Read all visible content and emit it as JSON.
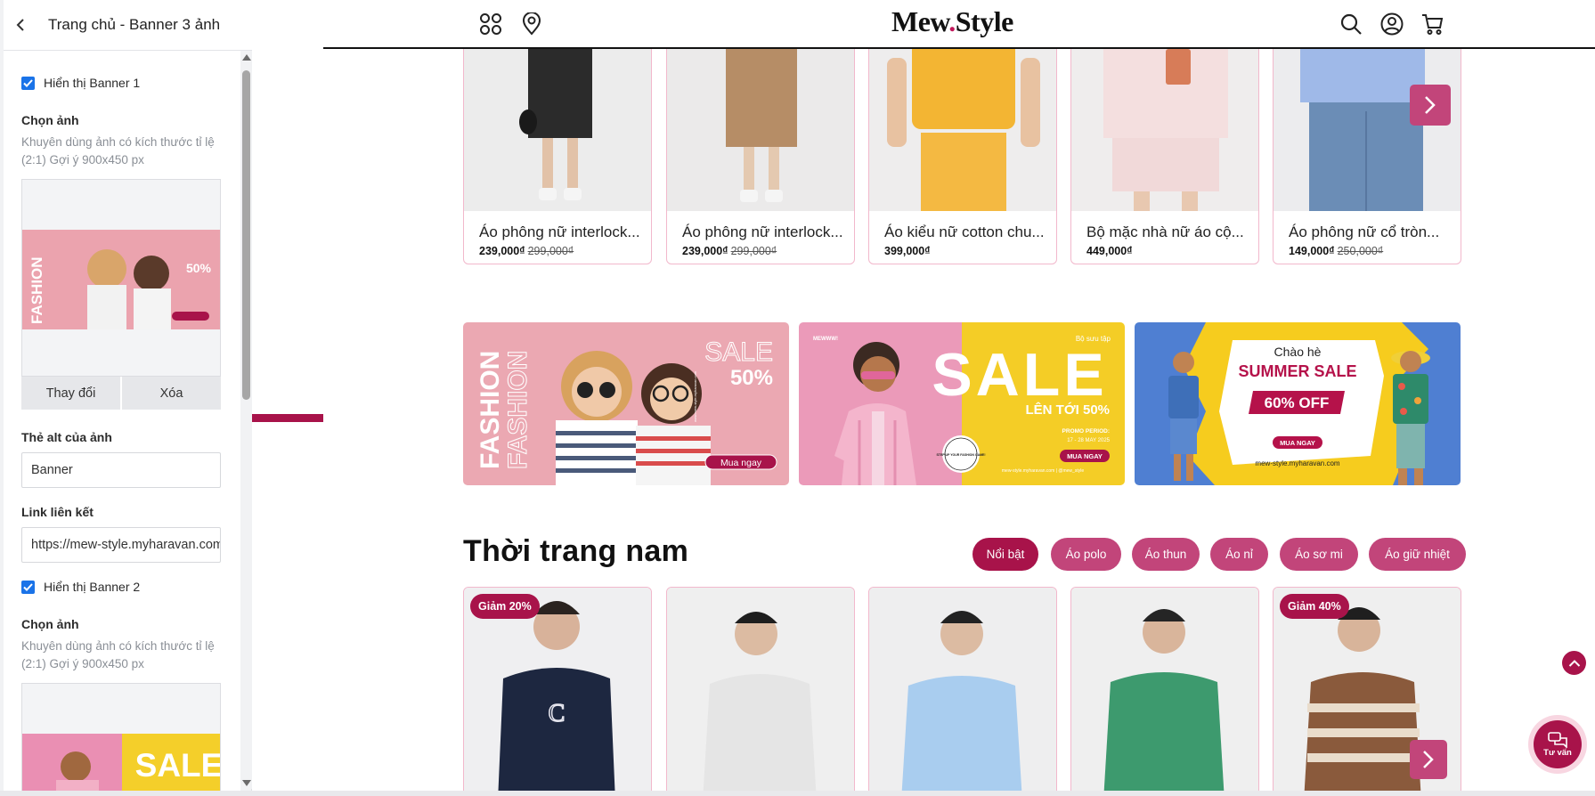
{
  "sidebar": {
    "title": "Trang chủ - Banner 3 ảnh",
    "banner1": {
      "show_label": "Hiển thị Banner 1",
      "choose_image_label": "Chọn ảnh",
      "hint": "Khuyên dùng ảnh có kích thước tỉ lệ (2:1) Gợi ý 900x450 px",
      "change_button": "Thay đổi",
      "delete_button": "Xóa",
      "alt_label": "Thẻ alt của ảnh",
      "alt_value": "Banner",
      "link_label": "Link liên kết",
      "link_value": "https://mew-style.myharavan.com"
    },
    "banner2": {
      "show_label": "Hiển thị Banner 2",
      "choose_image_label": "Chọn ảnh",
      "hint": "Khuyên dùng ảnh có kích thước tỉ lệ (2:1) Gợi ý 900x450 px"
    }
  },
  "site": {
    "logo_left": "Mew",
    "logo_dot": ".",
    "logo_right": "Style",
    "products_top": [
      {
        "name": "Áo phông nữ interlock...",
        "price": "239,000₫",
        "old_price": "299,000₫",
        "bg": "#ececec"
      },
      {
        "name": "Áo phông nữ interlock...",
        "price": "239,000₫",
        "old_price": "299,000₫",
        "bg": "#ebeaea"
      },
      {
        "name": "Áo kiểu nữ cotton chu...",
        "price": "399,000₫",
        "old_price": "",
        "bg": "#eeeded"
      },
      {
        "name": "Bộ mặc nhà nữ áo cộ...",
        "price": "449,000₫",
        "old_price": "",
        "bg": "#efeded"
      },
      {
        "name": "Áo phông nữ cổ tròn...",
        "price": "149,000₫",
        "old_price": "250,000₫",
        "bg": "#ececee"
      }
    ],
    "banners": {
      "b1": {
        "word1": "FASHION",
        "word2": "FASHION",
        "sale": "SALE",
        "pct": "50%",
        "cta": "Mua ngay",
        "url": "www.mew-style.myharavan.com"
      },
      "b2": {
        "brand": "MEWWW!",
        "collection": "Bộ sưu tập",
        "sale": "SALE",
        "upto": "LÊN TỚI 50%",
        "promo": "PROMO PERIOD:",
        "dates": "17 - 28 MAY 2025",
        "cta": "MUA NGAY",
        "stamp": "STEP UP YOUR FASHION GAME!",
        "footer": "mew-style.myharavan.com | @mew_style"
      },
      "b3": {
        "hello": "Chào hè",
        "summer": "SUMMER SALE",
        "off": "60% OFF",
        "cta": "MUA NGAY",
        "url": "mew-style.myharavan.com"
      }
    },
    "section": {
      "title": "Thời trang nam",
      "tabs": [
        "Nổi bật",
        "Áo polo",
        "Áo thun",
        "Áo nỉ",
        "Áo sơ mi",
        "Áo giữ nhiệt"
      ]
    },
    "badges": {
      "p1": "Giảm 20%",
      "p5": "Giảm 40%"
    },
    "chat_label": "Tư vấn"
  },
  "colors": {
    "accent": "#a8134a",
    "accent_light": "#c2457a",
    "card_border": "#f2b8cc",
    "checkbox": "#1a73e8"
  },
  "icons": [
    "back-icon",
    "grid-icon",
    "location-icon",
    "search-icon",
    "user-icon",
    "cart-icon",
    "chevron-right-icon",
    "chevron-up-icon",
    "chat-icon",
    "check-icon"
  ]
}
